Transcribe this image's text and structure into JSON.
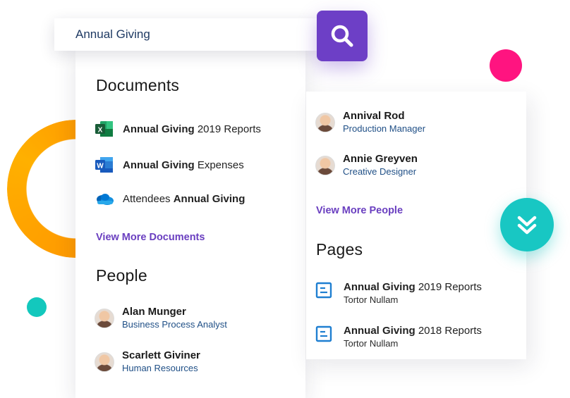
{
  "search": {
    "query": "Annual Giving"
  },
  "colors": {
    "accent": "#6d3fc6",
    "link": "#6a3fc0",
    "teal": "#18c7c3",
    "pink": "#ff1480",
    "orange": "#ff9a00"
  },
  "documents": {
    "title": "Documents",
    "items": [
      {
        "icon": "excel-icon",
        "bold": "Annual Giving",
        "rest": " 2019 Reports"
      },
      {
        "icon": "word-icon",
        "bold": "Annual Giving",
        "rest": " Expenses"
      },
      {
        "icon": "onedrive-icon",
        "pre": "Attendees ",
        "bold": "Annual Giving"
      }
    ],
    "more_label": "View More Documents"
  },
  "people": {
    "title": "People",
    "items": [
      {
        "name": "Alan Munger",
        "role": "Business Process Analyst"
      },
      {
        "name": "Scarlett Giviner",
        "role": "Human Resources"
      },
      {
        "name": "Annival Rod",
        "role": "Production Manager"
      },
      {
        "name": "Annie Greyven",
        "role": "Creative Designer"
      }
    ],
    "more_label": "View More People"
  },
  "pages": {
    "title": "Pages",
    "items": [
      {
        "bold": "Annual Giving",
        "rest": " 2019 Reports",
        "sub": "Tortor Nullam"
      },
      {
        "bold": "Annual Giving",
        "rest": " 2018 Reports",
        "sub": "Tortor Nullam"
      }
    ]
  },
  "icons": {
    "search": "search-icon",
    "scroll": "double-chevron-down-icon",
    "page": "page-icon"
  }
}
